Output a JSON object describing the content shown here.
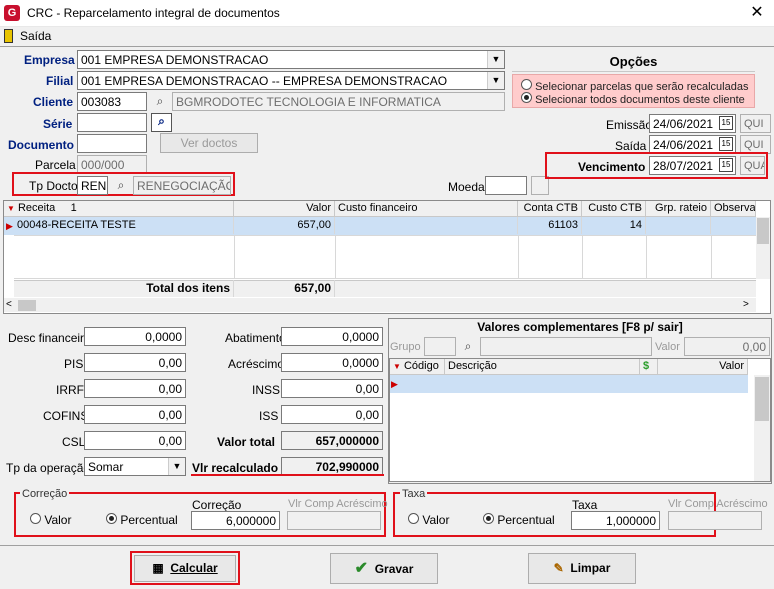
{
  "window": {
    "title": "CRC - Reparcelamento integral de documentos",
    "close": "✕"
  },
  "menu": {
    "saida": "Saída"
  },
  "form": {
    "empresa_label": "Empresa",
    "empresa_value": "001 EMPRESA DEMONSTRACAO",
    "filial_label": "Filial",
    "filial_value": "001 EMPRESA DEMONSTRACAO -- EMPRESA DEMONSTRACAO",
    "cliente_label": "Cliente",
    "cliente_code": "003083",
    "cliente_name": "BGMRODOTEC TECNOLOGIA  E INFORMATICA",
    "serie_label": "Série",
    "serie_value": "",
    "documento_label": "Documento",
    "documento_value": "",
    "ver_doctos": "Ver doctos",
    "parcela_label": "Parcela",
    "parcela_value": "000/000",
    "tpdocto_label": "Tp Docto",
    "tpdocto_code": "REN",
    "tpdocto_name": "RENEGOCIAÇÃO",
    "moeda_label": "Moeda",
    "moeda_value": ""
  },
  "opcoes": {
    "title": "Opções",
    "opt1": "Selecionar parcelas que serão recalculadas",
    "opt2": "Selecionar todos documentos deste cliente",
    "selected": 2
  },
  "dates": {
    "emissao_label": "Emissão",
    "emissao_value": "24/06/2021",
    "emissao_day": "QUI",
    "saida_label": "Saída",
    "saida_value": "24/06/2021",
    "saida_day": "QUI",
    "vencimento_label": "Vencimento",
    "vencimento_value": "28/07/2021",
    "vencimento_day": "QUA",
    "cal_label": "15"
  },
  "grid": {
    "columns": [
      "Receita",
      "Valor",
      "Custo financeiro",
      "Conta CTB",
      "Custo CTB",
      "Grp. rateio",
      "Observaç"
    ],
    "sort_indicator": "1",
    "rows": [
      {
        "receita": "00048-RECEITA TESTE",
        "valor": "657,00",
        "custo_fin": "",
        "conta_ctb": "61103",
        "custo_ctb": "14",
        "grp_rateio": "",
        "obs": ""
      }
    ],
    "total_label": "Total dos itens",
    "total_value": "657,00"
  },
  "valores": {
    "desc_fin_label": "Desc financeiro",
    "desc_fin": "0,0000",
    "pis_label": "PIS",
    "pis": "0,00",
    "irrf_label": "IRRF",
    "irrf": "0,00",
    "cofins_label": "COFINS",
    "cofins": "0,00",
    "csl_label": "CSL",
    "csl": "0,00",
    "tpop_label": "Tp da operação",
    "tpop": "Somar",
    "abatimento_label": "Abatimento",
    "abatimento": "0,0000",
    "acrescimo_label": "Acréscimo",
    "acrescimo": "0,0000",
    "inss_label": "INSS",
    "inss": "0,00",
    "iss_label": "ISS",
    "iss": "0,00",
    "valor_total_label": "Valor total",
    "valor_total": "657,000000",
    "vlr_recalc_label": "Vlr recalculado",
    "vlr_recalc": "702,990000"
  },
  "complementares": {
    "title": "Valores complementares [F8 p/ sair]",
    "grupo_label": "Grupo",
    "grupo_value": "",
    "valor_label": "Valor",
    "valor_value": "0,00",
    "col_codigo": "Código",
    "col_descricao": "Descrição",
    "col_valor": "Valor"
  },
  "correcao": {
    "group": "Correção",
    "opt_valor": "Valor",
    "opt_percentual": "Percentual",
    "selected": "percentual",
    "field_label": "Correção",
    "field_value": "6,000000",
    "comp_label": "Vlr Comp Acréscimo",
    "comp_value": ""
  },
  "taxa": {
    "group": "Taxa",
    "opt_valor": "Valor",
    "opt_percentual": "Percentual",
    "selected": "percentual",
    "field_label": "Taxa",
    "field_value": "1,000000",
    "comp_label": "Vlr Comp Acréscimo",
    "comp_value": ""
  },
  "buttons": {
    "calcular": "Calcular",
    "gravar": "Gravar",
    "limpar": "Limpar"
  },
  "colors": {
    "highlight": "#e0101a",
    "label_blue": "#002080",
    "selected_row": "#cce0f5"
  }
}
